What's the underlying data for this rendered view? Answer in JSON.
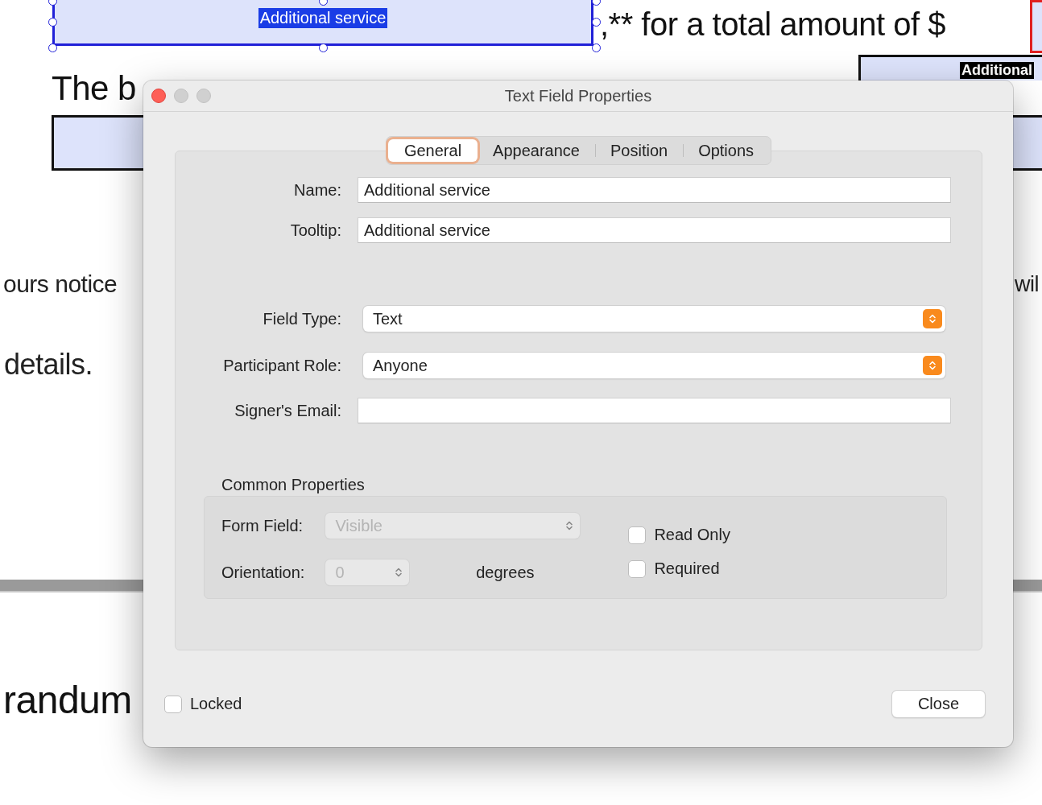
{
  "document": {
    "selected_field": {
      "value": "Additional service",
      "selected": true
    },
    "texts": [
      {
        "kind": "line",
        "text": ",** for a total amount of $"
      },
      {
        "kind": "line",
        "text": "The b"
      },
      {
        "kind": "body",
        "text": "ours notice"
      },
      {
        "kind": "body",
        "text": "wil"
      },
      {
        "kind": "body",
        "text": "details."
      },
      {
        "kind": "line",
        "text": "randum"
      }
    ],
    "other_field": {
      "value": "Additional"
    }
  },
  "dialog": {
    "title": "Text Field Properties",
    "tabs": [
      {
        "label": "General",
        "selected": true
      },
      {
        "label": "Appearance",
        "selected": false
      },
      {
        "label": "Position",
        "selected": false
      },
      {
        "label": "Options",
        "selected": false
      }
    ],
    "fields": [
      {
        "kind": "text",
        "label": "Name:",
        "value": "Additional service"
      },
      {
        "kind": "text",
        "label": "Tooltip:",
        "value": "Additional service"
      },
      {
        "kind": "popup",
        "label": "Field Type:",
        "value": "Text"
      },
      {
        "kind": "popup",
        "label": "Participant Role:",
        "value": "Anyone"
      },
      {
        "kind": "text",
        "label": "Signer's Email:"
      }
    ],
    "common_properties": {
      "title": "Common Properties",
      "form_field": {
        "label": "Form Field:",
        "value": "Visible",
        "disabled": true
      },
      "orientation": {
        "label": "Orientation:",
        "value": "0",
        "unit": "degrees",
        "disabled": true
      },
      "checkboxes": [
        {
          "label": "Read Only",
          "checked": false
        },
        {
          "label": "Required",
          "checked": false
        }
      ]
    },
    "locked": {
      "label": "Locked",
      "checked": false
    },
    "close_button": "Close"
  }
}
